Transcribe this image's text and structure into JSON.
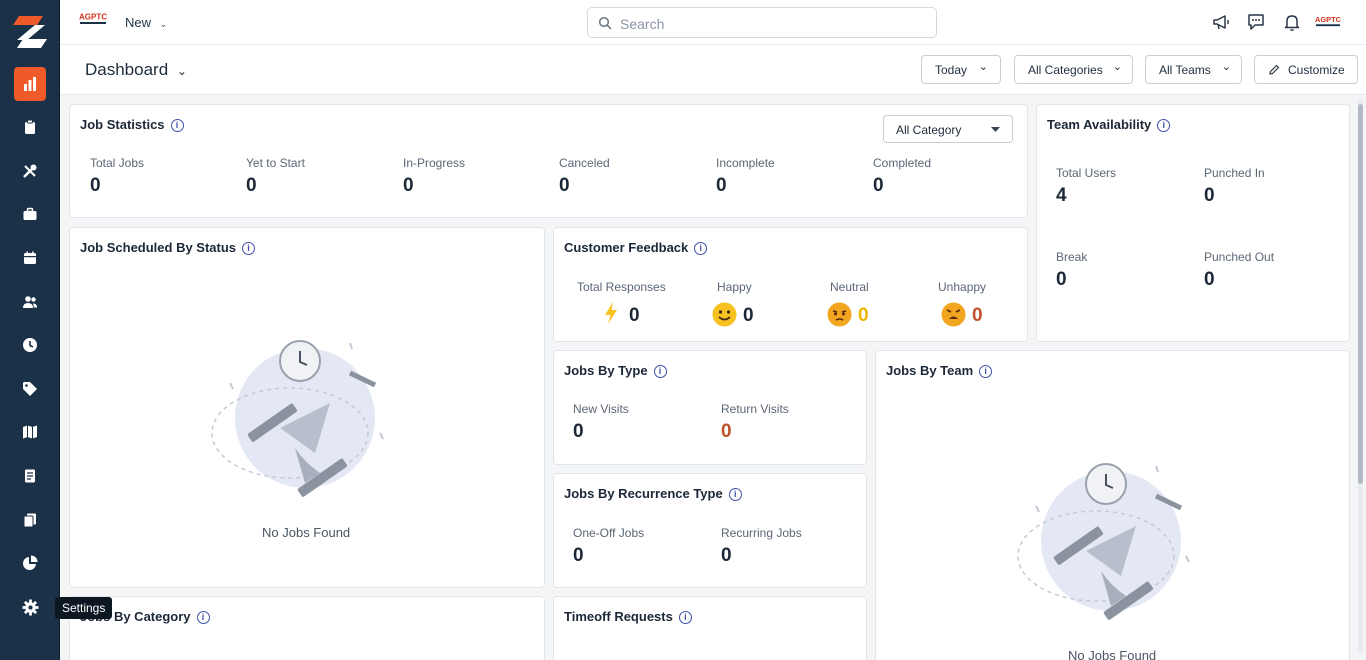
{
  "sidebar": {
    "icons": [
      "bar-chart-icon",
      "clipboard-icon",
      "tools-icon",
      "briefcase-icon",
      "calendar-icon",
      "users-icon",
      "clock-icon",
      "tag-icon",
      "map-icon",
      "document-icon",
      "copy-icon",
      "pie-chart-icon",
      "gear-icon"
    ],
    "tooltip": "Settings"
  },
  "topbar": {
    "new_label": "New",
    "search_placeholder": "Search",
    "brand_text": "AGPTC"
  },
  "header": {
    "title": "Dashboard",
    "filters": {
      "date": "Today",
      "categories": "All Categories",
      "teams": "All Teams"
    },
    "customize": "Customize"
  },
  "job_statistics": {
    "title": "Job Statistics",
    "category_select": "All Category",
    "stats": [
      {
        "label": "Total Jobs",
        "value": "0"
      },
      {
        "label": "Yet to Start",
        "value": "0"
      },
      {
        "label": "In-Progress",
        "value": "0"
      },
      {
        "label": "Canceled",
        "value": "0"
      },
      {
        "label": "Incomplete",
        "value": "0"
      },
      {
        "label": "Completed",
        "value": "0"
      }
    ]
  },
  "team_availability": {
    "title": "Team Availability",
    "stats": [
      {
        "label": "Total Users",
        "value": "4"
      },
      {
        "label": "Punched In",
        "value": "0"
      },
      {
        "label": "Break",
        "value": "0"
      },
      {
        "label": "Punched Out",
        "value": "0"
      }
    ]
  },
  "job_scheduled": {
    "title": "Job Scheduled By Status",
    "empty": "No Jobs Found"
  },
  "customer_feedback": {
    "title": "Customer Feedback",
    "items": [
      {
        "label": "Total Responses",
        "value": "0",
        "color": "#1c2838"
      },
      {
        "label": "Happy",
        "value": "0",
        "color": "#1c2838"
      },
      {
        "label": "Neutral",
        "value": "0",
        "color": "#f0b400"
      },
      {
        "label": "Unhappy",
        "value": "0",
        "color": "#c0502a"
      }
    ]
  },
  "jobs_by_type": {
    "title": "Jobs By Type",
    "stats": [
      {
        "label": "New Visits",
        "value": "0"
      },
      {
        "label": "Return Visits",
        "value": "0"
      }
    ]
  },
  "jobs_by_recurrence": {
    "title": "Jobs By Recurrence Type",
    "stats": [
      {
        "label": "One-Off Jobs",
        "value": "0"
      },
      {
        "label": "Recurring Jobs",
        "value": "0"
      }
    ]
  },
  "jobs_by_team": {
    "title": "Jobs By Team",
    "empty": "No Jobs Found"
  },
  "jobs_by_category": {
    "title": "Jobs By Category"
  },
  "timeoff": {
    "title": "Timeoff Requests"
  }
}
